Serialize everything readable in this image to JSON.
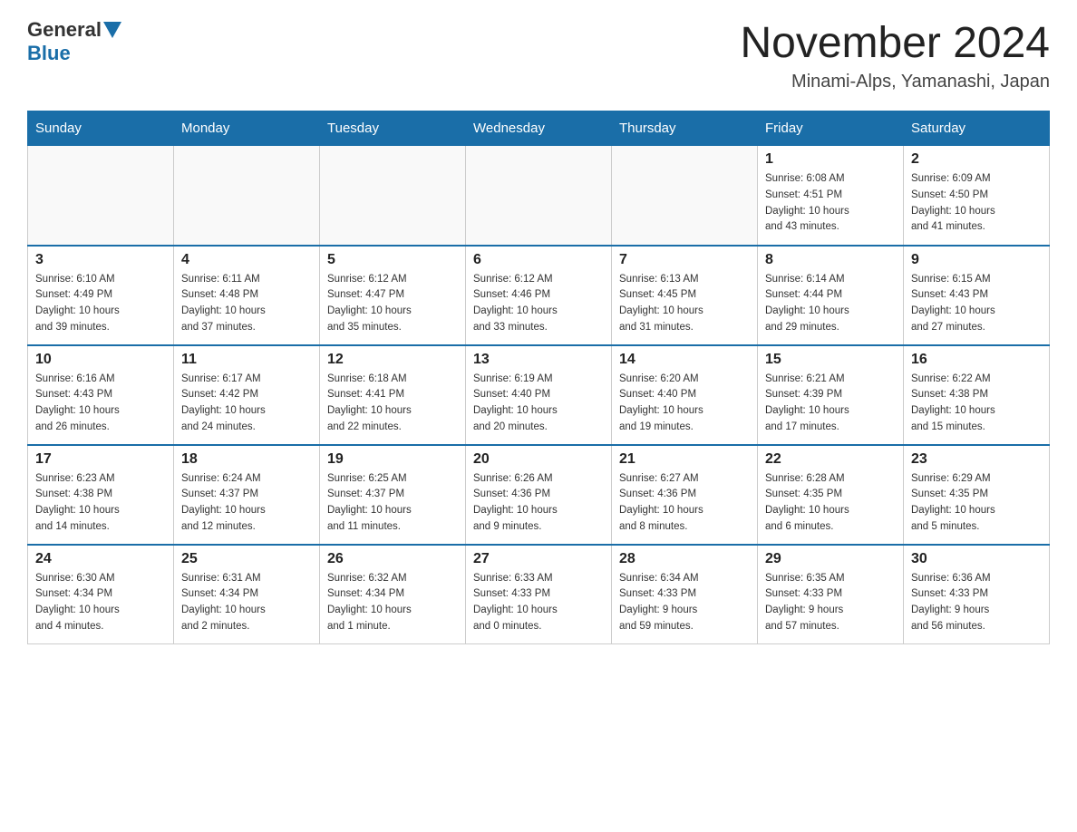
{
  "header": {
    "logo_general": "General",
    "logo_blue": "Blue",
    "month_title": "November 2024",
    "location": "Minami-Alps, Yamanashi, Japan"
  },
  "weekdays": [
    "Sunday",
    "Monday",
    "Tuesday",
    "Wednesday",
    "Thursday",
    "Friday",
    "Saturday"
  ],
  "weeks": [
    [
      {
        "day": "",
        "info": ""
      },
      {
        "day": "",
        "info": ""
      },
      {
        "day": "",
        "info": ""
      },
      {
        "day": "",
        "info": ""
      },
      {
        "day": "",
        "info": ""
      },
      {
        "day": "1",
        "info": "Sunrise: 6:08 AM\nSunset: 4:51 PM\nDaylight: 10 hours\nand 43 minutes."
      },
      {
        "day": "2",
        "info": "Sunrise: 6:09 AM\nSunset: 4:50 PM\nDaylight: 10 hours\nand 41 minutes."
      }
    ],
    [
      {
        "day": "3",
        "info": "Sunrise: 6:10 AM\nSunset: 4:49 PM\nDaylight: 10 hours\nand 39 minutes."
      },
      {
        "day": "4",
        "info": "Sunrise: 6:11 AM\nSunset: 4:48 PM\nDaylight: 10 hours\nand 37 minutes."
      },
      {
        "day": "5",
        "info": "Sunrise: 6:12 AM\nSunset: 4:47 PM\nDaylight: 10 hours\nand 35 minutes."
      },
      {
        "day": "6",
        "info": "Sunrise: 6:12 AM\nSunset: 4:46 PM\nDaylight: 10 hours\nand 33 minutes."
      },
      {
        "day": "7",
        "info": "Sunrise: 6:13 AM\nSunset: 4:45 PM\nDaylight: 10 hours\nand 31 minutes."
      },
      {
        "day": "8",
        "info": "Sunrise: 6:14 AM\nSunset: 4:44 PM\nDaylight: 10 hours\nand 29 minutes."
      },
      {
        "day": "9",
        "info": "Sunrise: 6:15 AM\nSunset: 4:43 PM\nDaylight: 10 hours\nand 27 minutes."
      }
    ],
    [
      {
        "day": "10",
        "info": "Sunrise: 6:16 AM\nSunset: 4:43 PM\nDaylight: 10 hours\nand 26 minutes."
      },
      {
        "day": "11",
        "info": "Sunrise: 6:17 AM\nSunset: 4:42 PM\nDaylight: 10 hours\nand 24 minutes."
      },
      {
        "day": "12",
        "info": "Sunrise: 6:18 AM\nSunset: 4:41 PM\nDaylight: 10 hours\nand 22 minutes."
      },
      {
        "day": "13",
        "info": "Sunrise: 6:19 AM\nSunset: 4:40 PM\nDaylight: 10 hours\nand 20 minutes."
      },
      {
        "day": "14",
        "info": "Sunrise: 6:20 AM\nSunset: 4:40 PM\nDaylight: 10 hours\nand 19 minutes."
      },
      {
        "day": "15",
        "info": "Sunrise: 6:21 AM\nSunset: 4:39 PM\nDaylight: 10 hours\nand 17 minutes."
      },
      {
        "day": "16",
        "info": "Sunrise: 6:22 AM\nSunset: 4:38 PM\nDaylight: 10 hours\nand 15 minutes."
      }
    ],
    [
      {
        "day": "17",
        "info": "Sunrise: 6:23 AM\nSunset: 4:38 PM\nDaylight: 10 hours\nand 14 minutes."
      },
      {
        "day": "18",
        "info": "Sunrise: 6:24 AM\nSunset: 4:37 PM\nDaylight: 10 hours\nand 12 minutes."
      },
      {
        "day": "19",
        "info": "Sunrise: 6:25 AM\nSunset: 4:37 PM\nDaylight: 10 hours\nand 11 minutes."
      },
      {
        "day": "20",
        "info": "Sunrise: 6:26 AM\nSunset: 4:36 PM\nDaylight: 10 hours\nand 9 minutes."
      },
      {
        "day": "21",
        "info": "Sunrise: 6:27 AM\nSunset: 4:36 PM\nDaylight: 10 hours\nand 8 minutes."
      },
      {
        "day": "22",
        "info": "Sunrise: 6:28 AM\nSunset: 4:35 PM\nDaylight: 10 hours\nand 6 minutes."
      },
      {
        "day": "23",
        "info": "Sunrise: 6:29 AM\nSunset: 4:35 PM\nDaylight: 10 hours\nand 5 minutes."
      }
    ],
    [
      {
        "day": "24",
        "info": "Sunrise: 6:30 AM\nSunset: 4:34 PM\nDaylight: 10 hours\nand 4 minutes."
      },
      {
        "day": "25",
        "info": "Sunrise: 6:31 AM\nSunset: 4:34 PM\nDaylight: 10 hours\nand 2 minutes."
      },
      {
        "day": "26",
        "info": "Sunrise: 6:32 AM\nSunset: 4:34 PM\nDaylight: 10 hours\nand 1 minute."
      },
      {
        "day": "27",
        "info": "Sunrise: 6:33 AM\nSunset: 4:33 PM\nDaylight: 10 hours\nand 0 minutes."
      },
      {
        "day": "28",
        "info": "Sunrise: 6:34 AM\nSunset: 4:33 PM\nDaylight: 9 hours\nand 59 minutes."
      },
      {
        "day": "29",
        "info": "Sunrise: 6:35 AM\nSunset: 4:33 PM\nDaylight: 9 hours\nand 57 minutes."
      },
      {
        "day": "30",
        "info": "Sunrise: 6:36 AM\nSunset: 4:33 PM\nDaylight: 9 hours\nand 56 minutes."
      }
    ]
  ]
}
